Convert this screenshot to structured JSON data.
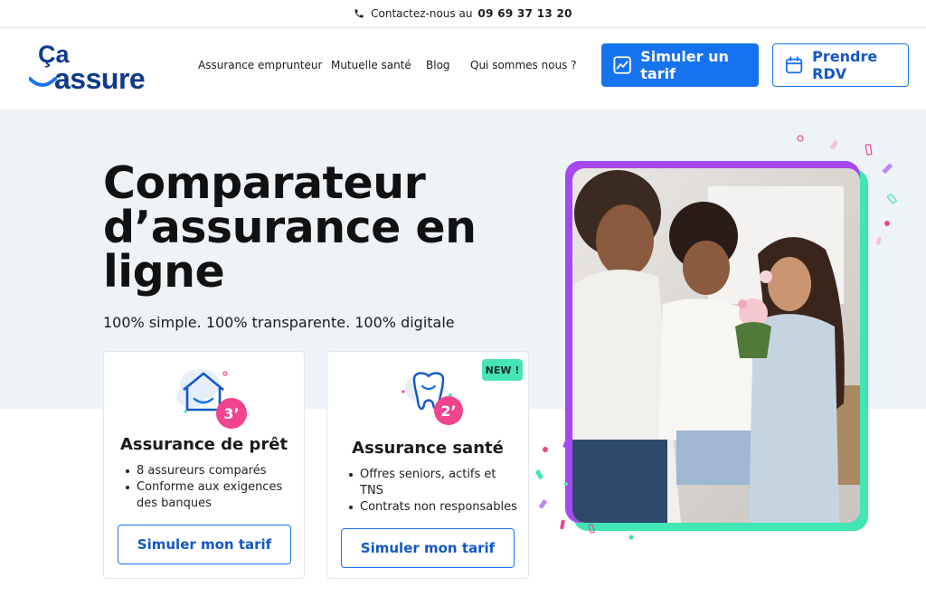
{
  "topbar": {
    "contact_label": "Contactez-nous au",
    "phone_number": "09 69 37 13 20"
  },
  "header": {
    "logo_text": "Ça assure",
    "nav": [
      "Assurance emprunteur",
      "Mutuelle santé",
      "Blog",
      "Qui sommes nous ?"
    ],
    "simulate_button": "Simuler un tarif",
    "appointment_button": "Prendre RDV"
  },
  "hero": {
    "title": "Comparateur d’assurance en ligne",
    "subtitle": "100% simple. 100% transparente. 100% digitale"
  },
  "cards": [
    {
      "title": "Assurance de prêt",
      "time_badge": "3’",
      "bullets": [
        "8 assureurs comparés",
        "Conforme aux exigences des banques"
      ],
      "button": "Simuler mon tarif",
      "icon": "house-icon"
    },
    {
      "title": "Assurance santé",
      "time_badge": "2’",
      "new_badge": "NEW !",
      "bullets": [
        "Offres seniors, actifs et TNS",
        "Contrats non responsables"
      ],
      "button": "Simuler mon tarif",
      "icon": "tooth-icon"
    }
  ],
  "colors": {
    "brand_blue": "#1673f0",
    "logo_navy": "#0f3a8c",
    "hero_background": "#eef3f8",
    "badge_pink": "#f1448e",
    "new_badge_green": "#45e5b8",
    "frame_purple": "#a647f0",
    "frame_green": "#40e6b4"
  },
  "icons": [
    "phone-icon",
    "chart-icon",
    "calendar-icon",
    "house-icon",
    "tooth-icon"
  ]
}
